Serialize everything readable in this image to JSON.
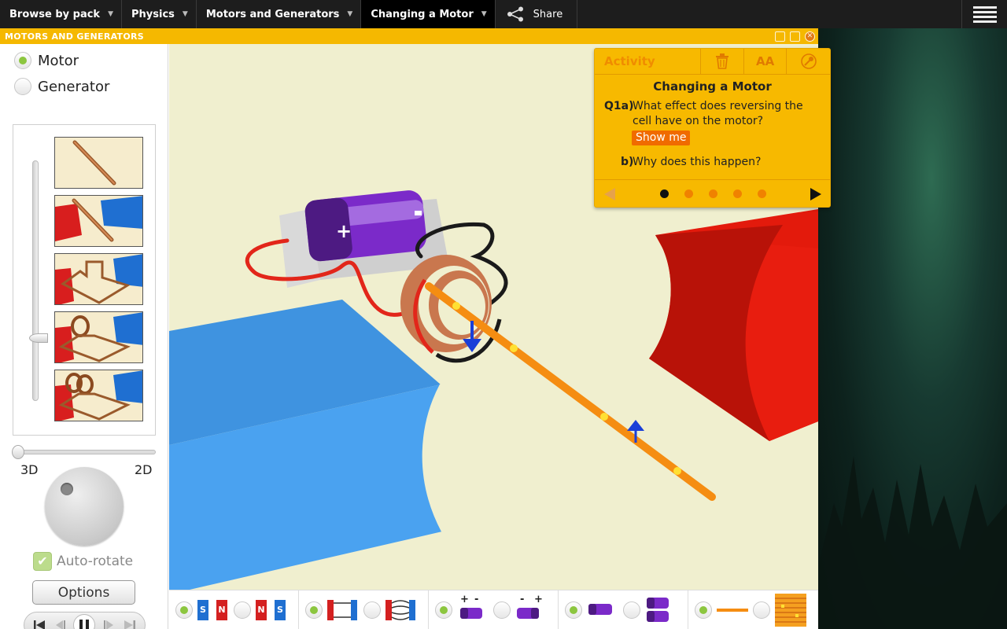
{
  "nav": {
    "items": [
      {
        "label": "Browse by pack"
      },
      {
        "label": "Physics"
      },
      {
        "label": "Motors and Generators"
      },
      {
        "label": "Changing a Motor"
      }
    ],
    "share_label": "Share"
  },
  "window": {
    "title": "MOTORS AND GENERATORS"
  },
  "left_panel": {
    "mode_options": [
      {
        "label": "Motor",
        "selected": true
      },
      {
        "label": "Generator",
        "selected": false
      }
    ],
    "view_left_label": "3D",
    "view_right_label": "2D",
    "autorotate_label": "Auto-rotate",
    "autorotate_checked": true,
    "options_label": "Options"
  },
  "activity": {
    "header_label": "Activity",
    "title": "Changing a Motor",
    "q1_number": "Q1a)",
    "q1_text_line1": "What effect does reversing the",
    "q1_text_line2": "cell have on the motor?",
    "show_me_label": "Show me",
    "q2_number": "b)",
    "q2_text": "Why does this happen?",
    "font_tool_label": "AA",
    "page_count": 5,
    "current_page": 1
  },
  "toolbar": {
    "groups": [
      {
        "magnets": [
          "S",
          "N",
          "N",
          "S"
        ]
      },
      {},
      {
        "battery_a_signs": [
          "+",
          "-"
        ],
        "battery_b_signs": [
          "-",
          "+"
        ]
      },
      {},
      {}
    ]
  },
  "colors": {
    "accent_yellow": "#f7b900",
    "accent_orange": "#f08200",
    "radio_selected": "#8cc63f",
    "magnet_north": "#d42020",
    "magnet_south": "#1f6fd1"
  }
}
